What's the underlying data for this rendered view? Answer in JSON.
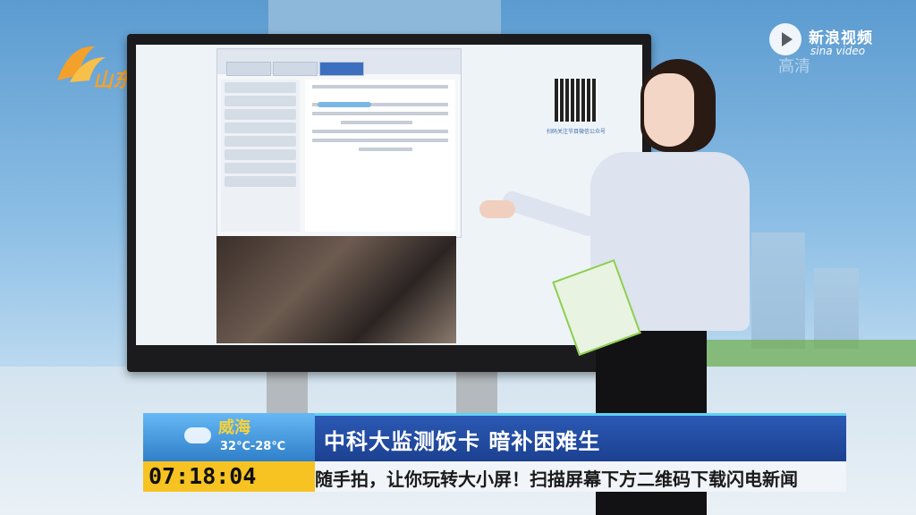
{
  "channel": {
    "logo_text": "山东",
    "logo_color": "#f3a12b"
  },
  "watermark": {
    "brand": "新浪视频",
    "brand_sub": "sina video",
    "quality": "高清"
  },
  "screen": {
    "qr_caption": "扫码关注节目微信公众号"
  },
  "ticker": {
    "city": "威海",
    "temperature": "32℃-28℃",
    "headline": "中科大监测饭卡 暗补困难生",
    "clock": "07:18:04",
    "scroll_text": "随手拍，让你玩转大小屏！扫描屏幕下方二维码下载闪电新闻"
  },
  "colors": {
    "headline_bg": "#2b59b4",
    "clock_bg": "#f6c323",
    "accent": "#5ed2f3"
  }
}
